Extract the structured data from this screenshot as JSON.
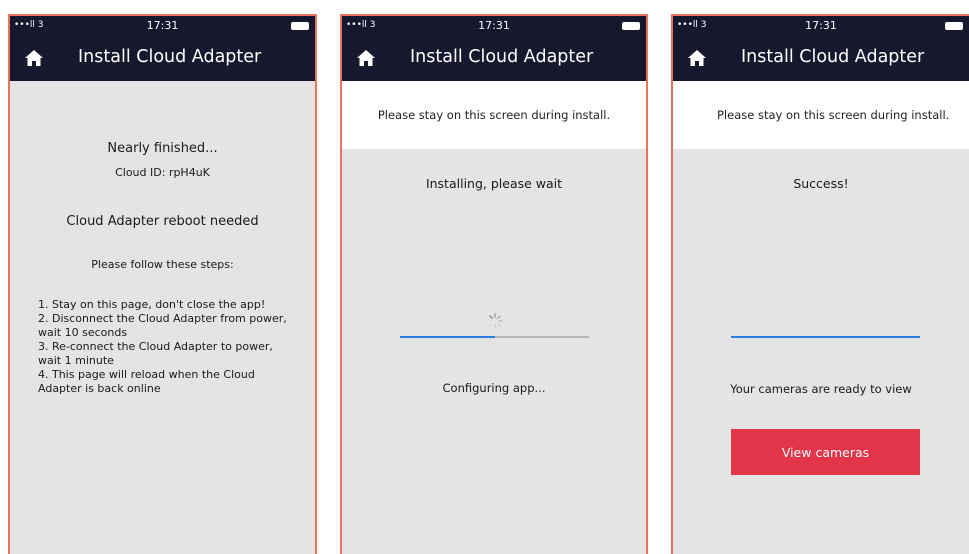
{
  "status_bar": {
    "signal": "•••ll 3",
    "time": "17:31"
  },
  "nav": {
    "title": "Install Cloud Adapter"
  },
  "screen1": {
    "heading": "Nearly finished...",
    "cloud_id": "Cloud ID: rpH4uK",
    "reboot": "Cloud Adapter reboot needed",
    "follow": "Please follow these steps:",
    "steps": [
      "1. Stay on this page, don't close the app!",
      "2. Disconnect the Cloud Adapter from power, wait 10 seconds",
      "3. Re-connect the Cloud Adapter to power, wait 1 minute",
      "4. This page will reload when the Cloud Adapter is back online"
    ]
  },
  "screen2": {
    "notice": "Please stay on this screen during install.",
    "heading": "Installing, please wait",
    "progress": 0.5,
    "status": "Configuring app..."
  },
  "screen3": {
    "notice": "Please stay on this screen during install.",
    "heading": "Success!",
    "progress": 1.0,
    "message": "Your cameras are ready to view",
    "button_label": "View cameras"
  },
  "colors": {
    "header_bg": "#17182d",
    "accent": "#e3354a",
    "progress": "#2d7de0",
    "frame": "#e8745e"
  }
}
